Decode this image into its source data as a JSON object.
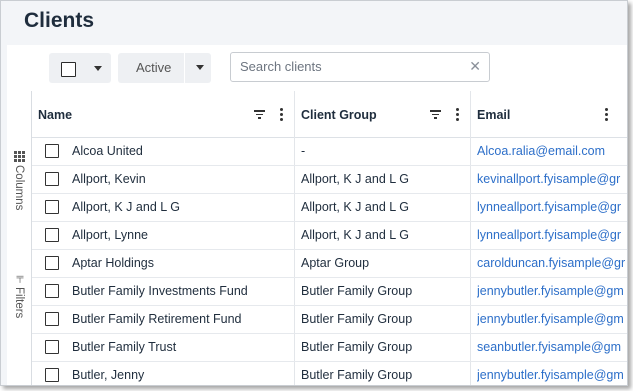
{
  "page": {
    "title": "Clients"
  },
  "toolbar": {
    "status_label": "Active",
    "search_placeholder": "Search clients",
    "clear_glyph": "✕"
  },
  "side_panel": {
    "columns_label": "Columns",
    "filters_label": "Filters",
    "filters_glyph": "⊩"
  },
  "table": {
    "headers": {
      "name": "Name",
      "group": "Client Group",
      "email": "Email"
    },
    "rows": [
      {
        "name": "Alcoa United",
        "group": "-",
        "email": "Alcoa.ralia@email.com"
      },
      {
        "name": "Allport, Kevin",
        "group": "Allport, K J and L G",
        "email": "kevinallport.fyisample@gr"
      },
      {
        "name": "Allport, K J and L G",
        "group": "Allport, K J and L G",
        "email": "lynneallport.fyisample@gr"
      },
      {
        "name": "Allport, Lynne",
        "group": "Allport, K J and L G",
        "email": "lynneallport.fyisample@gr"
      },
      {
        "name": "Aptar Holdings",
        "group": "Aptar Group",
        "email": "carolduncan.fyisample@gr"
      },
      {
        "name": "Butler Family Investments Fund",
        "group": "Butler Family Group",
        "email": "jennybutler.fyisample@gm"
      },
      {
        "name": "Butler Family Retirement Fund",
        "group": "Butler Family Group",
        "email": "jennybutler.fyisample@gm"
      },
      {
        "name": "Butler Family Trust",
        "group": "Butler Family Group",
        "email": "seanbutler.fyisample@gm"
      },
      {
        "name": "Butler, Jenny",
        "group": "Butler Family Group",
        "email": "jennybutler.fyisample@gm"
      }
    ]
  },
  "colors": {
    "accent_link": "#2d6fc9",
    "header_bg": "#f3f5f8"
  }
}
